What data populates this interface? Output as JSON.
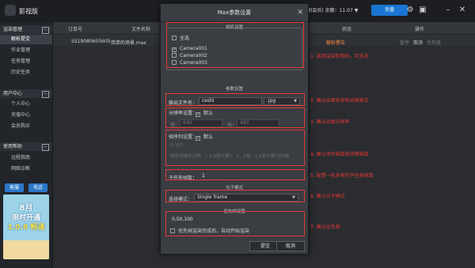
{
  "app": {
    "name": "影视版"
  },
  "topbar": {
    "user_text": "(注册会员)",
    "balance_label": "余额：11.07",
    "balance_arrow": "▼",
    "recharge_label": "充值",
    "icons": [
      "gear-icon",
      "monitor-icon",
      "minimize-icon",
      "close-icon"
    ]
  },
  "sidebar": {
    "sections": [
      {
        "label": "渲染管理",
        "toggle": "−",
        "items": [
          "解析提交",
          "作业管理",
          "任务管理",
          "历史任务"
        ]
      },
      {
        "label": "用户中心",
        "toggle": "−",
        "items": [
          "个人中心",
          "充值中心",
          "会员购买"
        ]
      },
      {
        "label": "使用帮助",
        "toggle": "−",
        "items": [
          "远程指南",
          "网络诊断"
        ]
      }
    ],
    "active_item": "解析提交",
    "btn_left": "客服",
    "btn_right": "电话",
    "banner": {
      "line1": "8月",
      "line2": "限时开通",
      "line3": "1.0.8 畅通"
    }
  },
  "table": {
    "headers": [
      "订单号",
      "文件名称",
      "状态",
      "操作"
    ],
    "rows": [
      {
        "order": "SS19080605605",
        "file": "简单的场景.max",
        "status": "解析警告",
        "actions": [
          "暂停",
          "取消",
          "优先级"
        ]
      }
    ]
  },
  "dialog": {
    "title": "Max参数设置",
    "close": "✕",
    "camera_legend": "相机设置",
    "select_all": "全选",
    "cameras": [
      {
        "name": "Camera001",
        "checked": true
      },
      {
        "name": "Camera002",
        "checked": false
      },
      {
        "name": "Camera003",
        "checked": false
      }
    ],
    "param_legend": "参数设置",
    "output_label": "输出文件名：",
    "output_name": "ceshi",
    "output_ext": ".jpg",
    "res_label": "分辨率设置：",
    "res_default": "默认",
    "width_label": "宽：",
    "width_value": "640",
    "height_label": "高：",
    "height_value": "480",
    "frame_label": "帧序列设置：",
    "frame_default": "默认",
    "frame_value": "0-100",
    "frame_hint": "帧序列格式示例：1,5,6表示第1、5、6帧 ; 1-5表示第1至5帧",
    "subtask_label": "子任务帧数：",
    "subtask_value": "1",
    "photon_legend": "光子模式",
    "photon_label": "选择模式：",
    "photon_value": "Single frame",
    "priority_legend": "优先帧设置",
    "priority_value": "0,50,100",
    "priority_check": "优先帧渲染完成后，自动开始渲染",
    "ok": "提交",
    "cancel": "取消"
  },
  "annotations": [
    "1. 选择渲染的相机，可多选",
    "2. 确认出图名称和出图格式",
    "3. 确认出图分辨率",
    "4. 确认序列帧数和间隔帧数",
    "5. 配置一机多帧的子任务帧数",
    "6. 确认光子模式",
    "7. 确认优先帧"
  ],
  "colors": {
    "accent": "#1976d2",
    "annotation": "#e53935",
    "warning": "#ff8a3d"
  }
}
